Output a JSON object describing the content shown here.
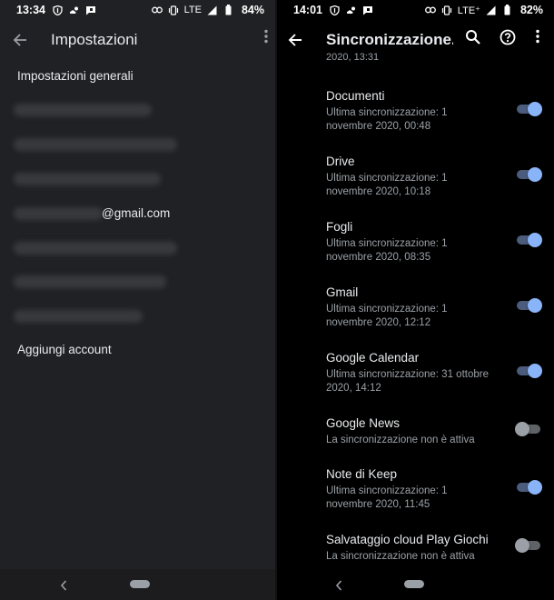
{
  "left": {
    "status": {
      "time": "13:34",
      "network": "LTE",
      "battery": "84%"
    },
    "title": "Impostazioni",
    "items": {
      "general": "Impostazioni generali",
      "gmail_suffix": "@gmail.com",
      "add_account": "Aggiungi account"
    }
  },
  "right": {
    "status": {
      "time": "14:01",
      "network": "LTE⁺",
      "battery": "82%"
    },
    "title": "Sincronizzazione...",
    "cut_text": "2020, 13:31",
    "rows": [
      {
        "title": "Documenti",
        "sub1": "Ultima sincronizzazione: 1",
        "sub2": "novembre 2020, 00:48",
        "enabled": true
      },
      {
        "title": "Drive",
        "sub1": "Ultima sincronizzazione: 1",
        "sub2": "novembre 2020, 10:18",
        "enabled": true
      },
      {
        "title": "Fogli",
        "sub1": "Ultima sincronizzazione: 1",
        "sub2": "novembre 2020, 08:35",
        "enabled": true
      },
      {
        "title": "Gmail",
        "sub1": "Ultima sincronizzazione: 1",
        "sub2": "novembre 2020, 12:12",
        "enabled": true
      },
      {
        "title": "Google Calendar",
        "sub1": "Ultima sincronizzazione: 31 ottobre",
        "sub2": "2020, 14:12",
        "enabled": true
      },
      {
        "title": "Google News",
        "sub1": "La sincronizzazione non è attiva",
        "sub2": "",
        "enabled": false
      },
      {
        "title": "Note di Keep",
        "sub1": "Ultima sincronizzazione: 1",
        "sub2": "novembre 2020, 11:45",
        "enabled": true
      },
      {
        "title": "Salvataggio cloud Play Giochi",
        "sub1": "La sincronizzazione non è attiva",
        "sub2": "",
        "enabled": false
      }
    ]
  },
  "icons": {
    "status_left": [
      "shield-icon",
      "weather-icon",
      "message-icon"
    ],
    "status_right": [
      "link-icon",
      "vibrate-icon",
      "signal-icon",
      "battery-icon"
    ],
    "appbar_left": [
      "back-arrow-icon",
      "more-vert-icon"
    ],
    "appbar_right": [
      "back-arrow-icon",
      "search-icon",
      "help-icon",
      "more-vert-icon"
    ],
    "nav": [
      "nav-back-icon",
      "nav-home-pill"
    ]
  },
  "colors": {
    "left_bg": "#202124",
    "right_bg": "#000000",
    "text_primary": "#e8eaed",
    "text_secondary": "#9aa0a6",
    "toggle_on": "#8ab4f8",
    "toggle_off": "#9aa0a6"
  }
}
